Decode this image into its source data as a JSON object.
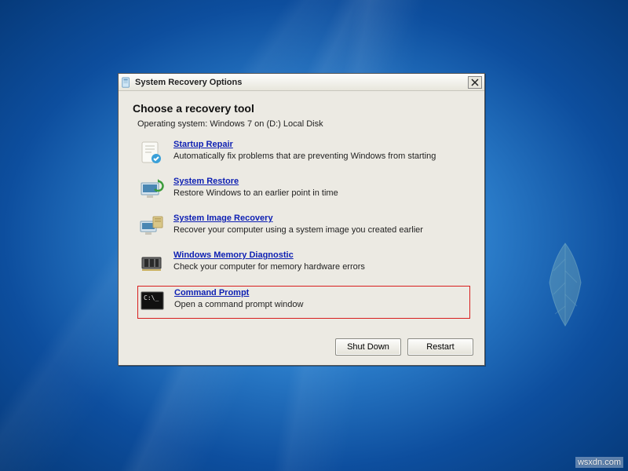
{
  "titlebar": {
    "title": "System Recovery Options"
  },
  "heading": "Choose a recovery tool",
  "subheading": "Operating system: Windows 7 on (D:) Local Disk",
  "tools": [
    {
      "title": "Startup Repair",
      "desc": "Automatically fix problems that are preventing Windows from starting"
    },
    {
      "title": "System Restore",
      "desc": "Restore Windows to an earlier point in time"
    },
    {
      "title": "System Image Recovery",
      "desc": "Recover your computer using a system image you created earlier"
    },
    {
      "title": "Windows Memory Diagnostic",
      "desc": "Check your computer for memory hardware errors"
    },
    {
      "title": "Command Prompt",
      "desc": "Open a command prompt window"
    }
  ],
  "buttons": {
    "shutdown": "Shut Down",
    "restart": "Restart"
  },
  "watermark": "wsxdn.com"
}
